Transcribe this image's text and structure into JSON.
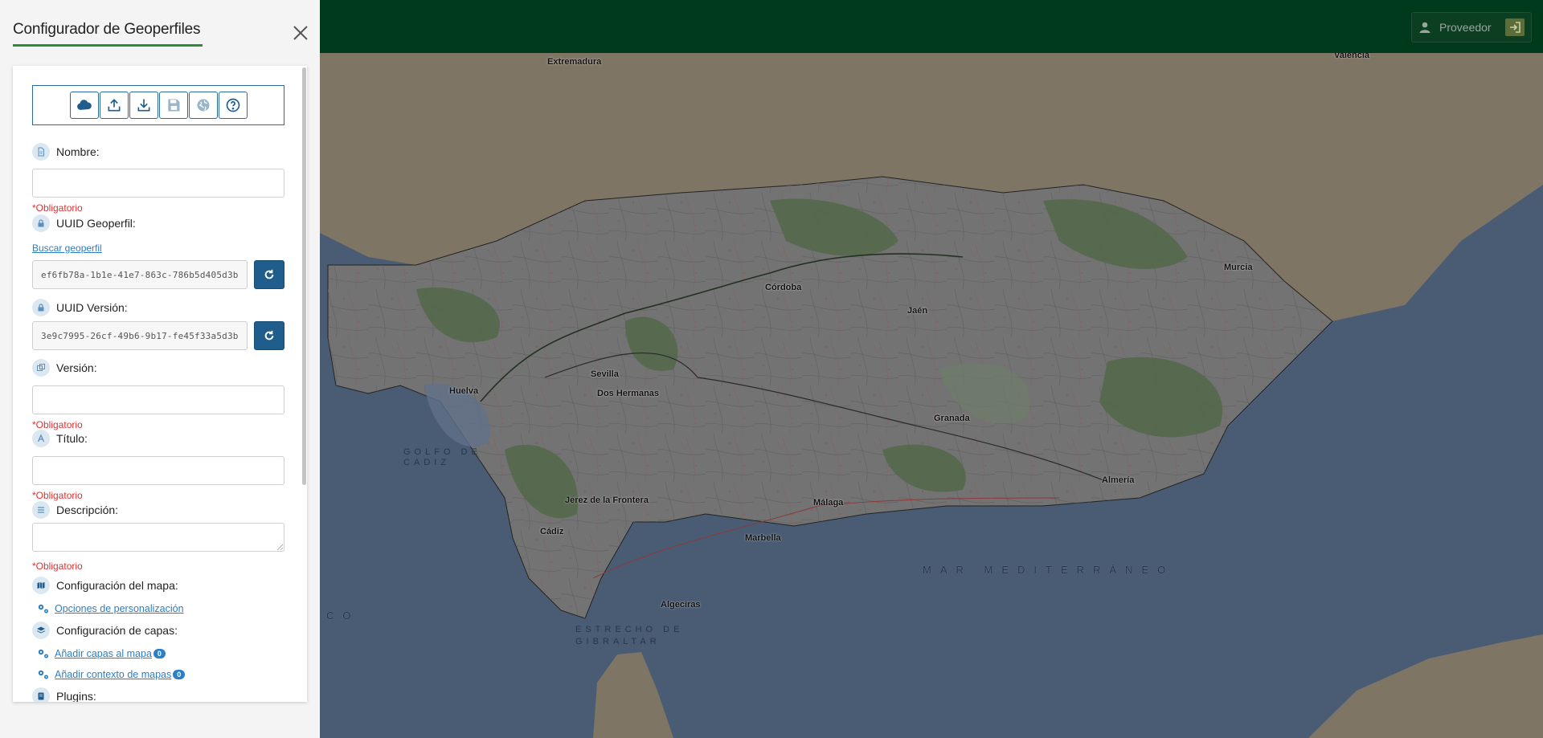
{
  "sidebar": {
    "title": "Configurador de Geoperfiles",
    "toolbar": [
      "cloud-icon",
      "upload-icon",
      "download-icon",
      "save-icon",
      "globe-icon",
      "help-icon"
    ],
    "fields": {
      "nombre": {
        "label": "Nombre:",
        "required": "*Obligatorio",
        "value": ""
      },
      "uuid_geoperfil": {
        "label": "UUID Geoperfil:",
        "link": "Buscar geoperfil",
        "value": "ef6fb78a-1b1e-41e7-863c-786b5d405d3b"
      },
      "uuid_version": {
        "label": "UUID Versión:",
        "value": "3e9c7995-26cf-49b6-9b17-fe45f33a5d3b"
      },
      "version": {
        "label": "Versión:",
        "required": "*Obligatorio",
        "value": ""
      },
      "titulo": {
        "label": "Título:",
        "required": "*Obligatorio",
        "value": ""
      },
      "descripcion": {
        "label": "Descripción:",
        "required": "*Obligatorio",
        "value": ""
      }
    },
    "map_config": {
      "label": "Configuración del mapa:",
      "link": "Opciones de personalización"
    },
    "layers_config": {
      "label": "Configuración de capas:",
      "add_layers": "Añadir capas al mapa",
      "add_layers_count": "0",
      "add_context": "Añadir contexto de mapas",
      "add_context_count": "0"
    },
    "plugins": {
      "label": "Plugins:"
    }
  },
  "header": {
    "login_label": "Proveedor"
  },
  "map": {
    "places": {
      "extremadura": "Extremadura",
      "valencia": "Valencia",
      "murcia": "Murcia",
      "cordoba": "Córdoba",
      "jaen": "Jaén",
      "sevilla": "Sevilla",
      "dos_hermanas": "Dos Hermanas",
      "huelva": "Huelva",
      "granada": "Granada",
      "almeria": "Almería",
      "jerez": "Jerez de la Frontera",
      "malaga": "Málaga",
      "cadiz": "Cádiz",
      "marbella": "Marbella",
      "algeciras": "Algeciras"
    },
    "seas": {
      "golfo_1": "GOLFO DE",
      "golfo_2": "CADIZ",
      "mediterraneo": "MAR MEDITERRÁNEO",
      "atlantico_frag": "CO",
      "estrecho_1": "ESTRECHO DE",
      "estrecho_2": "GIBRALTAR"
    },
    "colors": {
      "sea": "#4a5c74",
      "land_outside": "#7f7565",
      "andalucia": "#737373",
      "forest": "#52694a",
      "header": "#003a1c"
    }
  }
}
